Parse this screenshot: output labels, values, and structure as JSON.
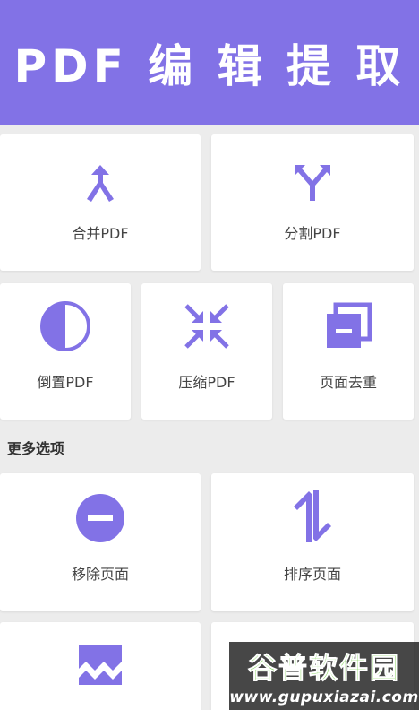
{
  "header": {
    "title": "PDF 编 辑 提 取"
  },
  "tools_top": [
    {
      "label": "合并PDF",
      "icon": "merge-arrows-icon"
    },
    {
      "label": "分割PDF",
      "icon": "split-arrows-icon"
    }
  ],
  "tools_mid": [
    {
      "label": "倒置PDF",
      "icon": "half-circle-icon"
    },
    {
      "label": "压缩PDF",
      "icon": "compress-arrows-icon"
    },
    {
      "label": "页面去重",
      "icon": "duplicate-pages-icon"
    }
  ],
  "more_section": {
    "title": "更多选项",
    "items": [
      {
        "label": "移除页面",
        "icon": "remove-circle-icon"
      },
      {
        "label": "排序页面",
        "icon": "swap-vertical-icon"
      }
    ]
  },
  "watermark": {
    "brand": "谷普软件园",
    "url": "www.gupuxiazai.com"
  },
  "colors": {
    "accent": "#8272e6",
    "background": "#ececec",
    "card": "#ffffff"
  }
}
